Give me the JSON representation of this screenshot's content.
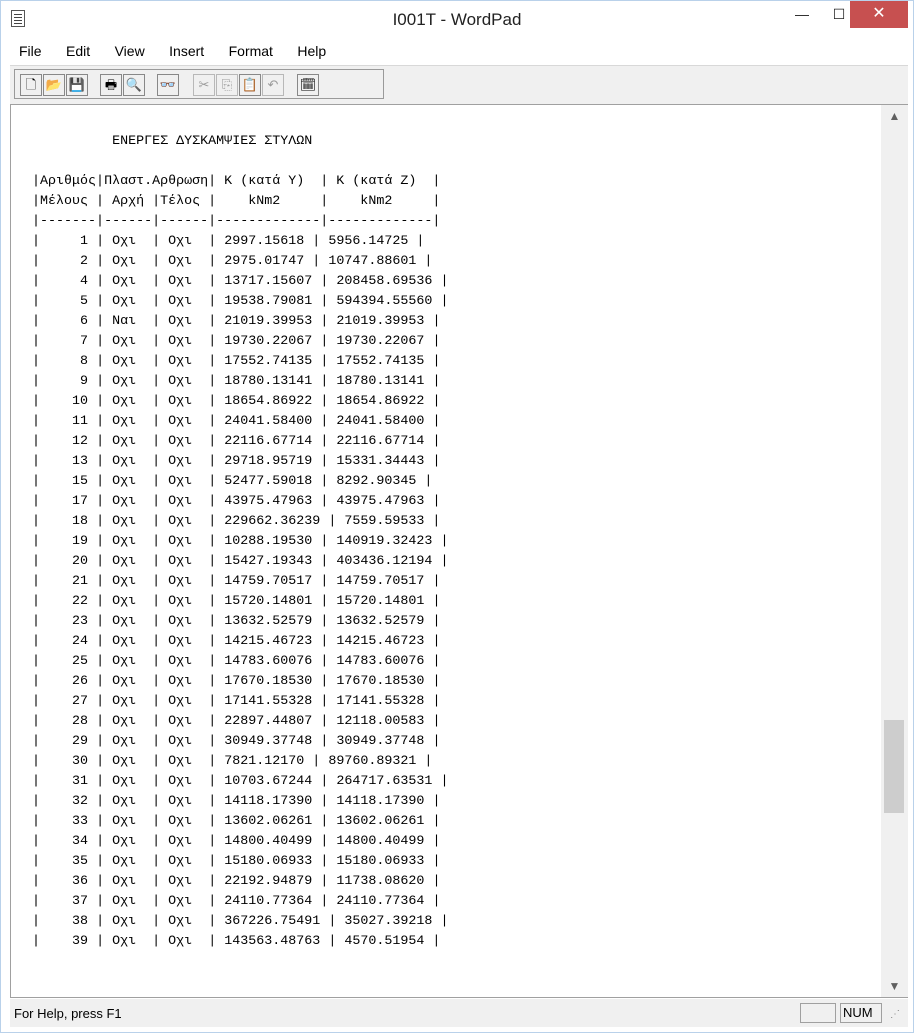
{
  "window": {
    "title": "I001T - WordPad",
    "min_glyph": "—",
    "max_glyph": "☐",
    "close_glyph": "✕"
  },
  "menu": [
    "File",
    "Edit",
    "View",
    "Insert",
    "Format",
    "Help"
  ],
  "toolbar": {
    "buttons": [
      {
        "name": "new-document-icon",
        "glyph": "🗋",
        "enabled": true
      },
      {
        "name": "open-folder-icon",
        "glyph": "📂",
        "enabled": true
      },
      {
        "name": "save-icon",
        "glyph": "💾",
        "enabled": true
      },
      {
        "name": "print-icon",
        "glyph": "🖶",
        "enabled": true
      },
      {
        "name": "print-preview-icon",
        "glyph": "🔍",
        "enabled": true
      },
      {
        "name": "find-binoculars-icon",
        "glyph": "👓",
        "enabled": true
      },
      {
        "name": "cut-icon",
        "glyph": "✂",
        "enabled": false
      },
      {
        "name": "copy-icon",
        "glyph": "⎘",
        "enabled": false
      },
      {
        "name": "paste-icon",
        "glyph": "📋",
        "enabled": true
      },
      {
        "name": "undo-icon",
        "glyph": "↶",
        "enabled": false
      },
      {
        "name": "insert-datetime-icon",
        "glyph": "🗓",
        "enabled": true
      }
    ]
  },
  "document": {
    "heading": "          ΕΝΕΡΓΕΣ ΔΥΣΚΑΜΨΙΕΣ ΣΤΥΛΩΝ",
    "header_lines": [
      "|Αριθμός|Πλαστ.Αρθρωση| K (κατά Y)  | K (κατά Z)  |",
      "|Μέλους | Αρχή |Τέλος |    kNm2     |    kNm2     |",
      "|-------|------|------|-------------|-------------|"
    ],
    "rows": [
      {
        "member": "1",
        "start": "Οχι",
        "end": "Οχι",
        "ky": "2997.15618",
        "kz": "5956.14725"
      },
      {
        "member": "2",
        "start": "Οχι",
        "end": "Οχι",
        "ky": "2975.01747",
        "kz": "10747.88601"
      },
      {
        "member": "4",
        "start": "Οχι",
        "end": "Οχι",
        "ky": "13717.15607",
        "kz": "208458.69536"
      },
      {
        "member": "5",
        "start": "Οχι",
        "end": "Οχι",
        "ky": "19538.79081",
        "kz": "594394.55560"
      },
      {
        "member": "6",
        "start": "Ναι",
        "end": "Οχι",
        "ky": "21019.39953",
        "kz": "21019.39953"
      },
      {
        "member": "7",
        "start": "Οχι",
        "end": "Οχι",
        "ky": "19730.22067",
        "kz": "19730.22067"
      },
      {
        "member": "8",
        "start": "Οχι",
        "end": "Οχι",
        "ky": "17552.74135",
        "kz": "17552.74135"
      },
      {
        "member": "9",
        "start": "Οχι",
        "end": "Οχι",
        "ky": "18780.13141",
        "kz": "18780.13141"
      },
      {
        "member": "10",
        "start": "Οχι",
        "end": "Οχι",
        "ky": "18654.86922",
        "kz": "18654.86922"
      },
      {
        "member": "11",
        "start": "Οχι",
        "end": "Οχι",
        "ky": "24041.58400",
        "kz": "24041.58400"
      },
      {
        "member": "12",
        "start": "Οχι",
        "end": "Οχι",
        "ky": "22116.67714",
        "kz": "22116.67714"
      },
      {
        "member": "13",
        "start": "Οχι",
        "end": "Οχι",
        "ky": "29718.95719",
        "kz": "15331.34443"
      },
      {
        "member": "15",
        "start": "Οχι",
        "end": "Οχι",
        "ky": "52477.59018",
        "kz": "8292.90345"
      },
      {
        "member": "17",
        "start": "Οχι",
        "end": "Οχι",
        "ky": "43975.47963",
        "kz": "43975.47963"
      },
      {
        "member": "18",
        "start": "Οχι",
        "end": "Οχι",
        "ky": "229662.36239",
        "kz": "7559.59533"
      },
      {
        "member": "19",
        "start": "Οχι",
        "end": "Οχι",
        "ky": "10288.19530",
        "kz": "140919.32423"
      },
      {
        "member": "20",
        "start": "Οχι",
        "end": "Οχι",
        "ky": "15427.19343",
        "kz": "403436.12194"
      },
      {
        "member": "21",
        "start": "Οχι",
        "end": "Οχι",
        "ky": "14759.70517",
        "kz": "14759.70517"
      },
      {
        "member": "22",
        "start": "Οχι",
        "end": "Οχι",
        "ky": "15720.14801",
        "kz": "15720.14801"
      },
      {
        "member": "23",
        "start": "Οχι",
        "end": "Οχι",
        "ky": "13632.52579",
        "kz": "13632.52579"
      },
      {
        "member": "24",
        "start": "Οχι",
        "end": "Οχι",
        "ky": "14215.46723",
        "kz": "14215.46723"
      },
      {
        "member": "25",
        "start": "Οχι",
        "end": "Οχι",
        "ky": "14783.60076",
        "kz": "14783.60076"
      },
      {
        "member": "26",
        "start": "Οχι",
        "end": "Οχι",
        "ky": "17670.18530",
        "kz": "17670.18530"
      },
      {
        "member": "27",
        "start": "Οχι",
        "end": "Οχι",
        "ky": "17141.55328",
        "kz": "17141.55328"
      },
      {
        "member": "28",
        "start": "Οχι",
        "end": "Οχι",
        "ky": "22897.44807",
        "kz": "12118.00583"
      },
      {
        "member": "29",
        "start": "Οχι",
        "end": "Οχι",
        "ky": "30949.37748",
        "kz": "30949.37748"
      },
      {
        "member": "30",
        "start": "Οχι",
        "end": "Οχι",
        "ky": "7821.12170",
        "kz": "89760.89321"
      },
      {
        "member": "31",
        "start": "Οχι",
        "end": "Οχι",
        "ky": "10703.67244",
        "kz": "264717.63531"
      },
      {
        "member": "32",
        "start": "Οχι",
        "end": "Οχι",
        "ky": "14118.17390",
        "kz": "14118.17390"
      },
      {
        "member": "33",
        "start": "Οχι",
        "end": "Οχι",
        "ky": "13602.06261",
        "kz": "13602.06261"
      },
      {
        "member": "34",
        "start": "Οχι",
        "end": "Οχι",
        "ky": "14800.40499",
        "kz": "14800.40499"
      },
      {
        "member": "35",
        "start": "Οχι",
        "end": "Οχι",
        "ky": "15180.06933",
        "kz": "15180.06933"
      },
      {
        "member": "36",
        "start": "Οχι",
        "end": "Οχι",
        "ky": "22192.94879",
        "kz": "11738.08620"
      },
      {
        "member": "37",
        "start": "Οχι",
        "end": "Οχι",
        "ky": "24110.77364",
        "kz": "24110.77364"
      },
      {
        "member": "38",
        "start": "Οχι",
        "end": "Οχι",
        "ky": "367226.75491",
        "kz": "35027.39218"
      },
      {
        "member": "39",
        "start": "Οχι",
        "end": "Οχι",
        "ky": "143563.48763",
        "kz": "4570.51954"
      }
    ]
  },
  "scrollbar": {
    "up_glyph": "▲",
    "down_glyph": "▼",
    "position_fraction": 0.72
  },
  "status": {
    "help_text": "For Help, press F1",
    "num_indicator": "NUM",
    "grip_glyph": "⋰"
  }
}
